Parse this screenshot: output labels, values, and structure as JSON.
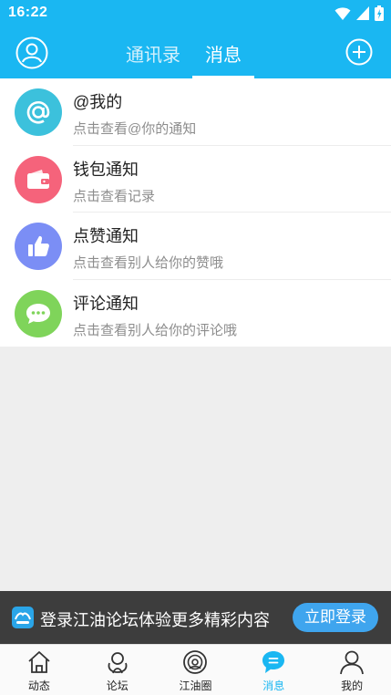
{
  "status_bar": {
    "time": "16:22",
    "icons": [
      "wifi-icon",
      "signal-icon",
      "battery-icon"
    ]
  },
  "header": {
    "tabs": [
      {
        "label": "通讯录",
        "active": false
      },
      {
        "label": "消息",
        "active": true
      }
    ],
    "left_icon": "avatar-icon",
    "right_icon": "plus-icon"
  },
  "notifications": [
    {
      "title": "@我的",
      "subtitle": "点击查看@你的通知",
      "icon": "at-icon",
      "color": "#3cc1dc"
    },
    {
      "title": "钱包通知",
      "subtitle": "点击查看记录",
      "icon": "wallet-icon",
      "color": "#f5637b"
    },
    {
      "title": "点赞通知",
      "subtitle": "点击查看别人给你的赞哦",
      "icon": "thumbs-up-icon",
      "color": "#7b8ef5"
    },
    {
      "title": "评论通知",
      "subtitle": "点击查看别人给你的评论哦",
      "icon": "comment-icon",
      "color": "#7fd45a"
    }
  ],
  "login_banner": {
    "text": "登录江油论坛体验更多精彩内容",
    "button": "立即登录"
  },
  "bottom_nav": [
    {
      "label": "动态",
      "icon": "home-icon",
      "active": false
    },
    {
      "label": "论坛",
      "icon": "forum-icon",
      "active": false
    },
    {
      "label": "江油圈",
      "icon": "circle-icon",
      "active": false
    },
    {
      "label": "消息",
      "icon": "message-icon",
      "active": true
    },
    {
      "label": "我的",
      "icon": "profile-icon",
      "active": false
    }
  ],
  "colors": {
    "primary": "#1ab7f2",
    "banner_bg": "#3d3d3d",
    "login_button": "#3fa5ee"
  }
}
